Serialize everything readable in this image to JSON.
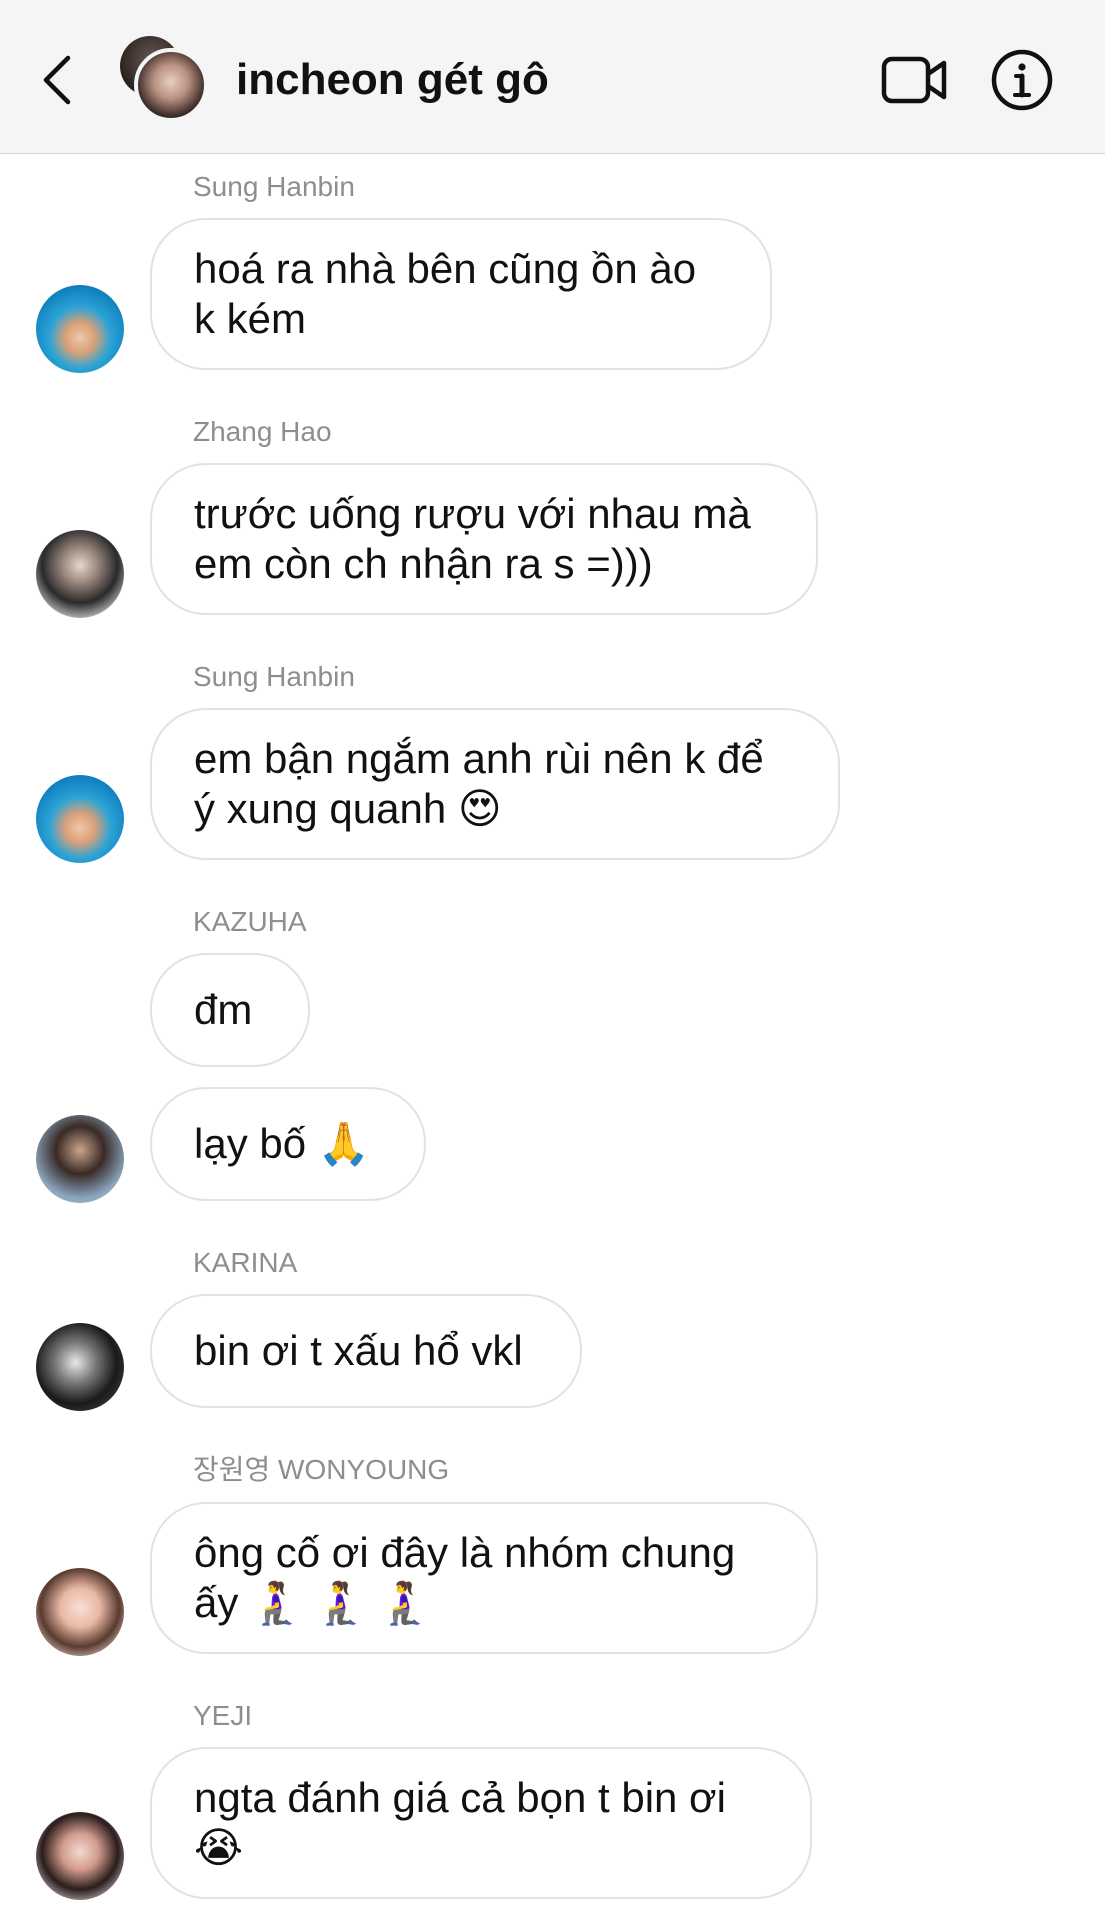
{
  "header": {
    "title": "incheon gét gô",
    "back_icon": "chevron-left-icon",
    "video_icon": "video-camera-icon",
    "info_icon": "info-circle-icon"
  },
  "messages": [
    {
      "sender": "Sung Hanbin",
      "lines": [
        "hoá ra nhà bên cũng ồn ào",
        "k kém"
      ]
    },
    {
      "sender": "Zhang Hao",
      "lines": [
        "trước uống rượu với nhau mà",
        "em còn ch nhận ra s =)))"
      ]
    },
    {
      "sender": "Sung Hanbin",
      "lines": [
        "em bận ngắm anh rùi nên k để",
        "ý xung quanh 😍"
      ]
    },
    {
      "sender": "KAZUHA",
      "lines": [
        "đm"
      ]
    },
    {
      "sender": "",
      "lines": [
        "lạy bố 🙏"
      ]
    },
    {
      "sender": "KARINA",
      "lines": [
        "bin ơi t xấu hổ vkl"
      ]
    },
    {
      "sender": "장원영 WONYOUNG",
      "lines": [
        "ông cố ơi đây là nhóm chung",
        "ấy 🧎‍♀️ 🧎‍♀️ 🧎‍♀️"
      ]
    },
    {
      "sender": "YEJI",
      "lines": [
        "ngta đánh giá cả bọn t bin ơi",
        "😭"
      ]
    }
  ]
}
